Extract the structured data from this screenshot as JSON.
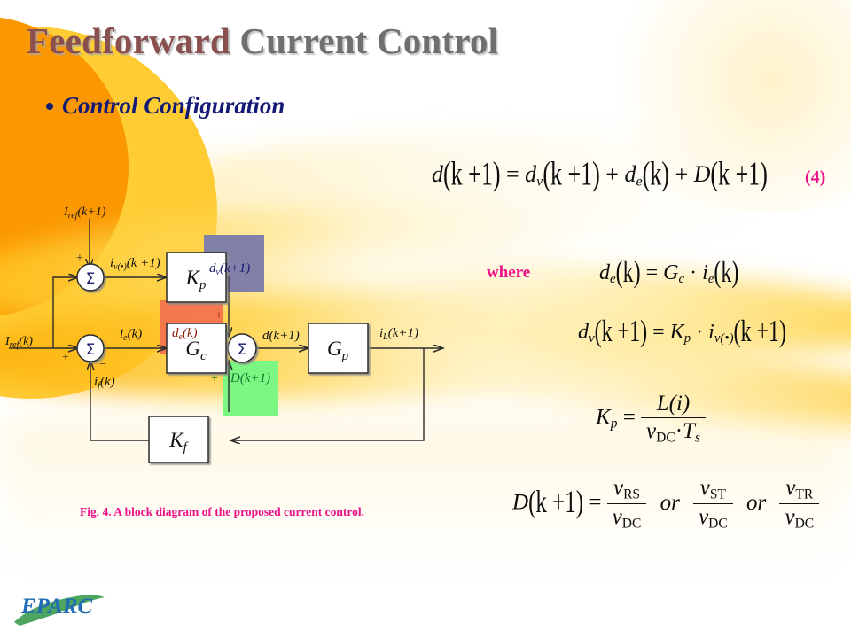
{
  "slide": {
    "title_part1": "Feedforward ",
    "title_part2": "Current Control",
    "bullet": "Control Configuration",
    "caption": "Fig. 4. A block diagram of the proposed current control.",
    "where_label": "where",
    "equation_number": "(4)"
  },
  "colors": {
    "title_accent": "#8a5050",
    "title_gray": "#6f6f6f",
    "bullet_blue": "#131a75",
    "pink": "#ee1289",
    "sun_orange": "#fb9700",
    "sun_yellow": "#ffcc33",
    "box_purple": "#8080a8",
    "box_red": "#f4704f",
    "box_green": "#7cf783",
    "label_dv": "#1a1a6e",
    "label_de": "#8b1a0a",
    "label_D": "#0f7a2a"
  },
  "equations": {
    "eq4": {
      "lhs_d": "d",
      "lhs_arg": "(k +1)",
      "eq": "=",
      "t1_base": "d",
      "t1_sub": "v",
      "t1_arg": "(k +1)",
      "plus1": "+",
      "t2_base": "d",
      "t2_sub": "e",
      "t2_arg": "(k)",
      "plus2": "+",
      "t3_base": "D",
      "t3_arg": "(k +1)"
    },
    "eq_de": {
      "lhs_base": "d",
      "lhs_sub": "e",
      "lhs_arg": "(k)",
      "eq": "=",
      "rhs_base": "G",
      "rhs_sub": "c",
      "dot": "·",
      "rhs2_base": "i",
      "rhs2_sub": "e",
      "rhs2_arg": "(k)"
    },
    "eq_dv": {
      "lhs_base": "d",
      "lhs_sub": "v",
      "lhs_arg": "(k +1)",
      "eq": "=",
      "rhs_base": "K",
      "rhs_sub": "p",
      "dot": "·",
      "rhs2_base": "i",
      "rhs2_sub": "v(•)",
      "rhs2_arg": "(k +1)"
    },
    "eq_kp": {
      "lhs_base": "K",
      "lhs_sub": "p",
      "eq": "=",
      "num_base": "L",
      "num_arg": "(i)",
      "den_base": "v",
      "den_sub": "DC",
      "dot": "·",
      "den2_base": "T",
      "den2_sub": "s"
    },
    "eq_D": {
      "lhs_base": "D",
      "lhs_arg": "(k +1)",
      "eq": "=",
      "f1_num_base": "v",
      "f1_num_sub": "RS",
      "f1_den_base": "v",
      "f1_den_sub": "DC",
      "or1": "or",
      "f2_num_base": "v",
      "f2_num_sub": "ST",
      "f2_den_base": "v",
      "f2_den_sub": "DC",
      "or2": "or",
      "f3_num_base": "v",
      "f3_num_sub": "TR",
      "f3_den_base": "v",
      "f3_den_sub": "DC"
    }
  },
  "diagram": {
    "blocks": [
      {
        "id": "kp",
        "label_base": "K",
        "label_sub": "p"
      },
      {
        "id": "gc",
        "label_base": "G",
        "label_sub": "c"
      },
      {
        "id": "gp",
        "label_base": "G",
        "label_sub": "p"
      },
      {
        "id": "kf",
        "label_base": "K",
        "label_sub": "f"
      }
    ],
    "summers": [
      {
        "id": "sum-top",
        "symbol": "Σ",
        "signs": [
          "+",
          "−"
        ]
      },
      {
        "id": "sum-bottom",
        "symbol": "Σ",
        "signs": [
          "+",
          "−"
        ]
      },
      {
        "id": "sum-adder",
        "symbol": "Σ",
        "signs": [
          "+",
          "+",
          "+"
        ]
      }
    ],
    "signals": {
      "iref_k1_base": "I",
      "iref_k1_sub": "ref",
      "iref_k1_arg": "(k+1)",
      "iref_k_base": "I",
      "iref_k_sub": "ref",
      "iref_k_arg": "(k)",
      "iv_base": "i",
      "iv_sub": "v(•)",
      "iv_arg": "(k +1)",
      "ie_base": "i",
      "ie_sub": "e",
      "ie_arg": "(k)",
      "if_base": "i",
      "if_sub": "f",
      "if_arg": "(k)",
      "dv_base": "d",
      "dv_sub": "v",
      "dv_arg": "(k+1)",
      "de_base": "d",
      "de_sub": "e",
      "de_arg": "(k)",
      "dD_base": "D",
      "dD_arg": "(k+1)",
      "dk1_base": "d",
      "dk1_arg": "(k+1)",
      "iL_base": "i",
      "iL_sub": "L",
      "iL_arg": "(k+1)"
    }
  },
  "logo": {
    "text": "EPARC"
  }
}
